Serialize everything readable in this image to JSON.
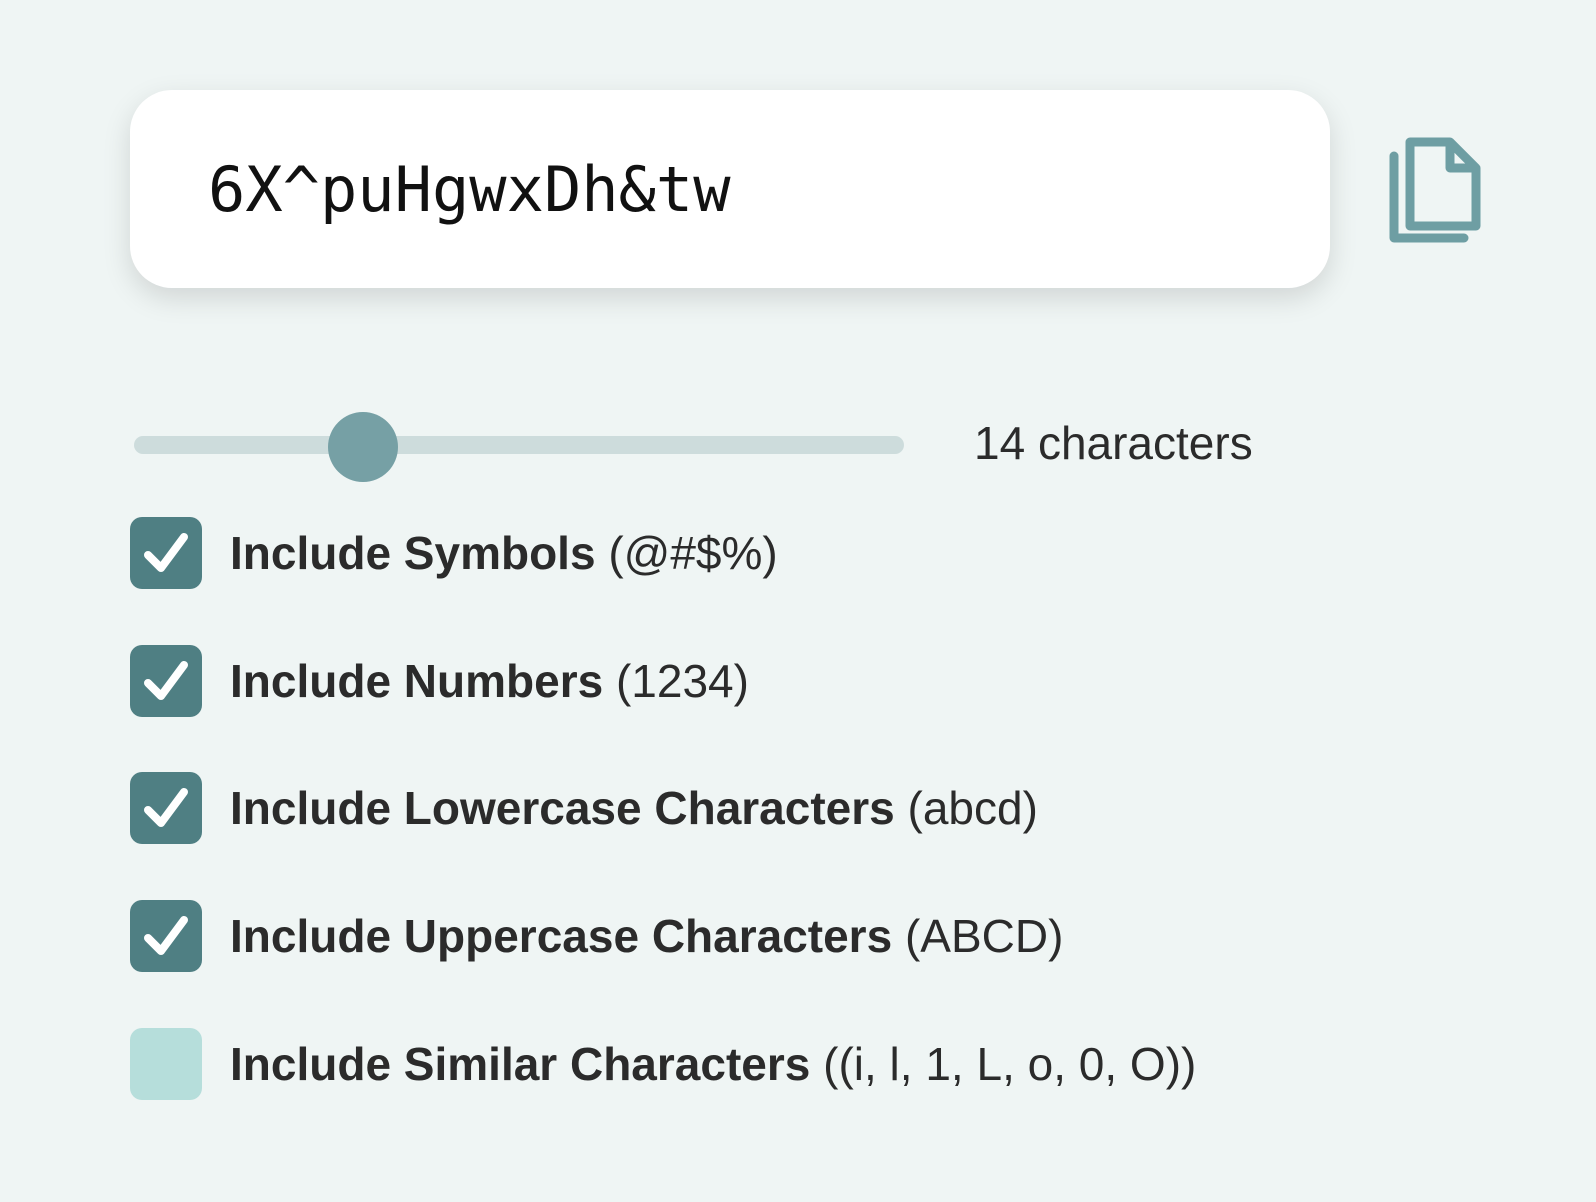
{
  "password": {
    "value": "6X^puHgwxDh&tw"
  },
  "copy_button": {
    "icon": "copy-icon"
  },
  "length": {
    "value": 14,
    "min": 4,
    "max": 40,
    "label": "14 characters"
  },
  "options": [
    {
      "label": "Include Symbols",
      "hint": "(@#$%)",
      "checked": true
    },
    {
      "label": "Include Numbers",
      "hint": "(1234)",
      "checked": true
    },
    {
      "label": "Include Lowercase Characters",
      "hint": "(abcd)",
      "checked": true
    },
    {
      "label": "Include Uppercase Characters",
      "hint": "(ABCD)",
      "checked": true
    },
    {
      "label": "Include Similar Characters",
      "hint": "((i, l, 1, L, o, 0, O))",
      "checked": false
    }
  ],
  "colors": {
    "background": "#eff5f4",
    "checkbox_checked": "#4f7f83",
    "checkbox_unchecked": "#b6dedb",
    "slider_track": "#cddcdc",
    "slider_thumb": "#76a0a5",
    "copy_icon": "#6e9ea3"
  }
}
